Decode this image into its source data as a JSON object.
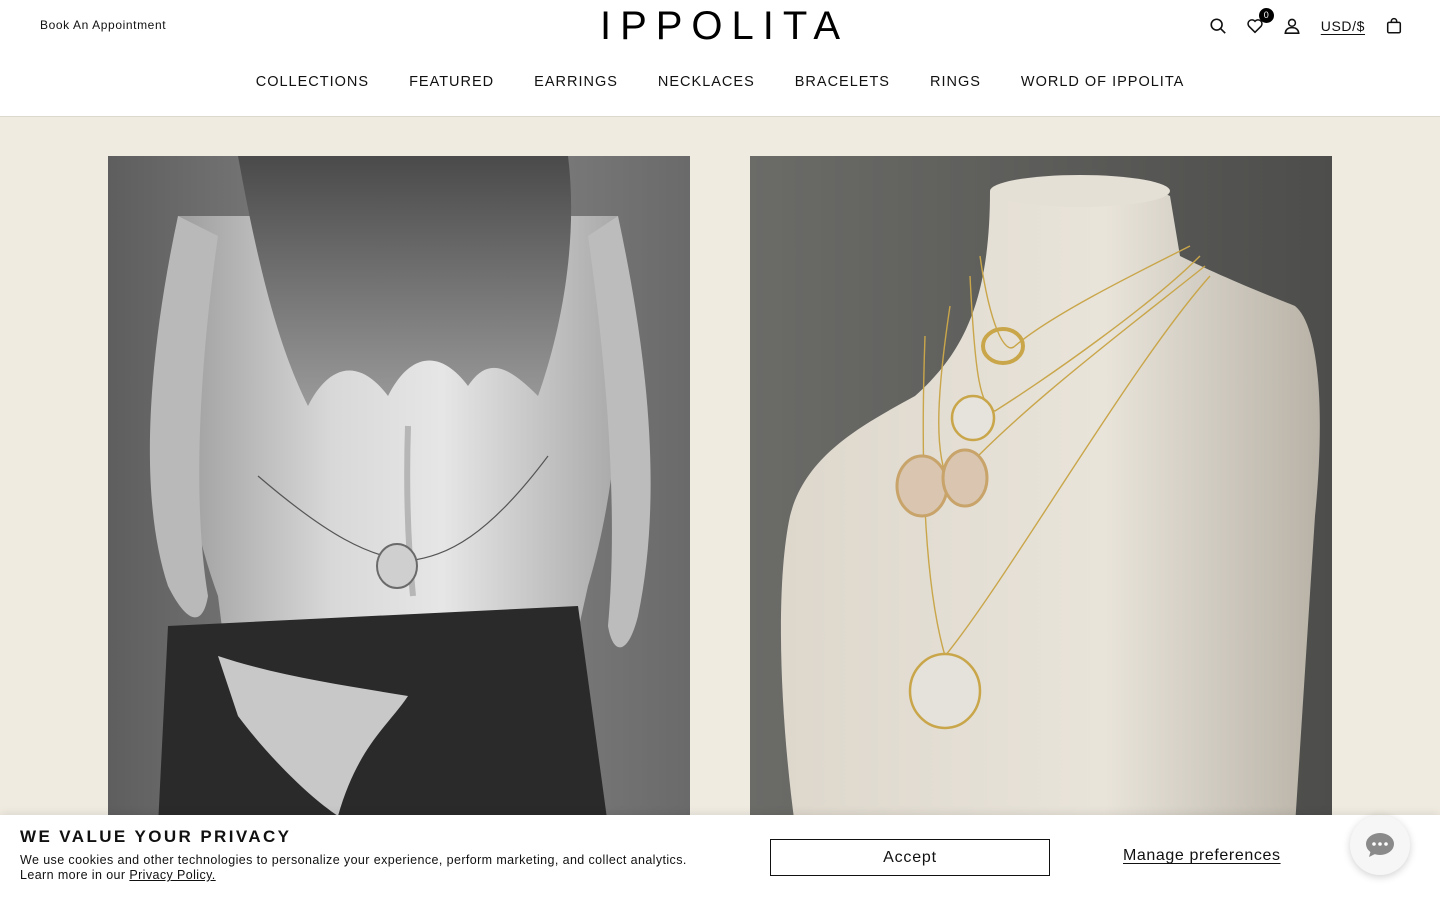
{
  "header": {
    "appointment_link": "Book An Appointment",
    "logo": "IPPOLITA",
    "wishlist_count": "0",
    "currency": "USD/$",
    "icons": [
      "search-icon",
      "heart-icon",
      "user-icon",
      "bag-icon"
    ]
  },
  "nav": {
    "items": [
      "COLLECTIONS",
      "FEATURED",
      "EARRINGS",
      "NECKLACES",
      "BRACELETS",
      "RINGS",
      "WORLD OF IPPOLITA"
    ]
  },
  "colors": {
    "page_background": "#efebe1",
    "header_background": "#ffffff",
    "text": "#111111"
  },
  "cookie_banner": {
    "title": "WE VALUE YOUR PRIVACY",
    "text_line1": "We use cookies and other technologies to personalize your experience, perform marketing, and collect analytics.",
    "text_line2_prefix": "Learn more in our ",
    "privacy_link": "Privacy Policy.",
    "accept_label": "Accept",
    "manage_label": "Manage preferences"
  }
}
